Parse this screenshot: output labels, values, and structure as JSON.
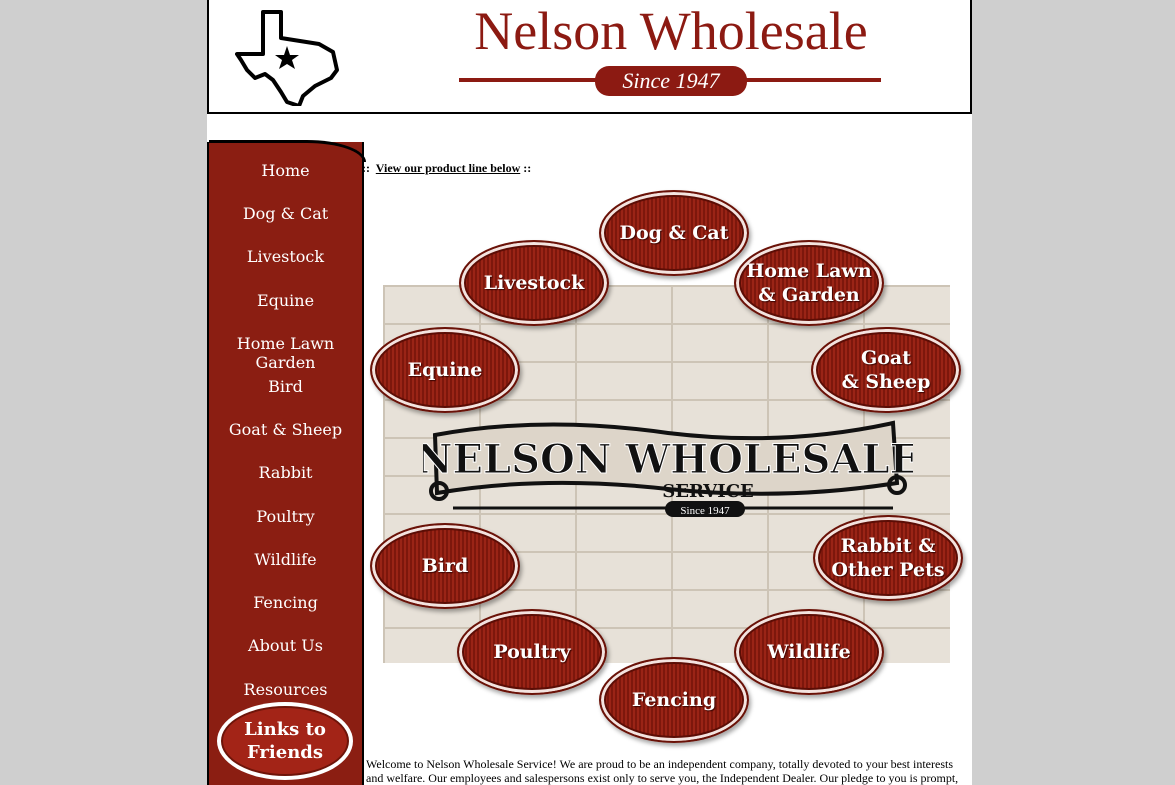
{
  "header": {
    "title": "Nelson Wholesale",
    "since": "Since 1947"
  },
  "sidebar": {
    "items": [
      {
        "label": "Home"
      },
      {
        "label": "Dog & Cat"
      },
      {
        "label": "Livestock"
      },
      {
        "label": "Equine"
      },
      {
        "label": "Home Lawn Garden"
      },
      {
        "label": "Bird"
      },
      {
        "label": "Goat & Sheep"
      },
      {
        "label": "Rabbit"
      },
      {
        "label": "Poultry"
      },
      {
        "label": "Wildlife"
      },
      {
        "label": "Fencing"
      },
      {
        "label": "About Us"
      },
      {
        "label": "Resources"
      }
    ],
    "links_button": {
      "line1": "Links to",
      "line2": "Friends"
    }
  },
  "main": {
    "view_prefix": "::",
    "view_link": "View our product line below",
    "view_suffix": "::",
    "sign": {
      "line1": "NELSON WHOLESALE",
      "line2": "SERVICE",
      "line3": "Since 1947"
    },
    "categories": {
      "dog_cat": {
        "line1": "Dog & Cat",
        "line2": ""
      },
      "livestock": {
        "line1": "Livestock",
        "line2": ""
      },
      "home_lawn": {
        "line1": "Home Lawn",
        "line2": "& Garden"
      },
      "equine": {
        "line1": "Equine",
        "line2": ""
      },
      "goat_sheep": {
        "line1": "Goat",
        "line2": "& Sheep"
      },
      "bird": {
        "line1": "Bird",
        "line2": ""
      },
      "rabbit": {
        "line1": "Rabbit &",
        "line2": "Other Pets"
      },
      "poultry": {
        "line1": "Poultry",
        "line2": ""
      },
      "wildlife": {
        "line1": "Wildlife",
        "line2": ""
      },
      "fencing": {
        "line1": "Fencing",
        "line2": ""
      }
    },
    "welcome_text": "Welcome to Nelson Wholesale Service! We are proud to be an independent company, totally devoted to your best interests and welfare. Our employees and salespersons exist only to serve you, the Independent Dealer. Our pledge to you is prompt,"
  },
  "colors": {
    "brand_red": "#8c1a12",
    "sidebar_red": "#8b1e12",
    "background_gray": "#cfcfcf"
  }
}
